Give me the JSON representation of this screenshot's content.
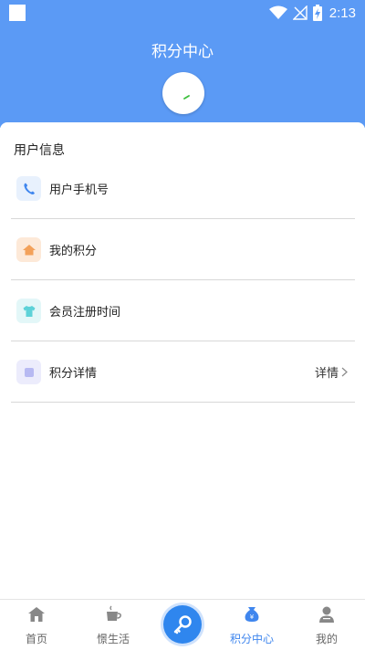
{
  "status_bar": {
    "time": "2:13",
    "icons": [
      "app-square-icon",
      "wifi-icon",
      "no-signal-icon",
      "battery-charging-icon"
    ]
  },
  "header": {
    "title": "积分中心",
    "bg_color": "#5b9af5"
  },
  "user_info": {
    "section_title": "用户信息",
    "rows": [
      {
        "label": "用户手机号",
        "icon": "phone-icon",
        "icon_bg": "#e8f1fd",
        "icon_color": "#3f86ee"
      },
      {
        "label": "我的积分",
        "icon": "house-icon",
        "icon_bg": "#fde9d8",
        "icon_color": "#f3a15a"
      },
      {
        "label": "会员注册时间",
        "icon": "shirt-icon",
        "icon_bg": "#e3f7f8",
        "icon_color": "#5dd2d8"
      },
      {
        "label": "积分详情",
        "icon": "square-icon",
        "icon_bg": "#ececfc",
        "icon_color": "#b7b9f2",
        "detail": "详情"
      }
    ]
  },
  "tabbar": {
    "items": [
      {
        "label": "首页",
        "icon": "home-icon"
      },
      {
        "label": "憬生活",
        "icon": "cup-icon"
      },
      {
        "label": "积分中心",
        "icon": "money-bag-icon",
        "active": true
      },
      {
        "label": "我的",
        "icon": "person-icon"
      }
    ],
    "center_icon": "key-icon",
    "active_color": "#3f86ee"
  }
}
